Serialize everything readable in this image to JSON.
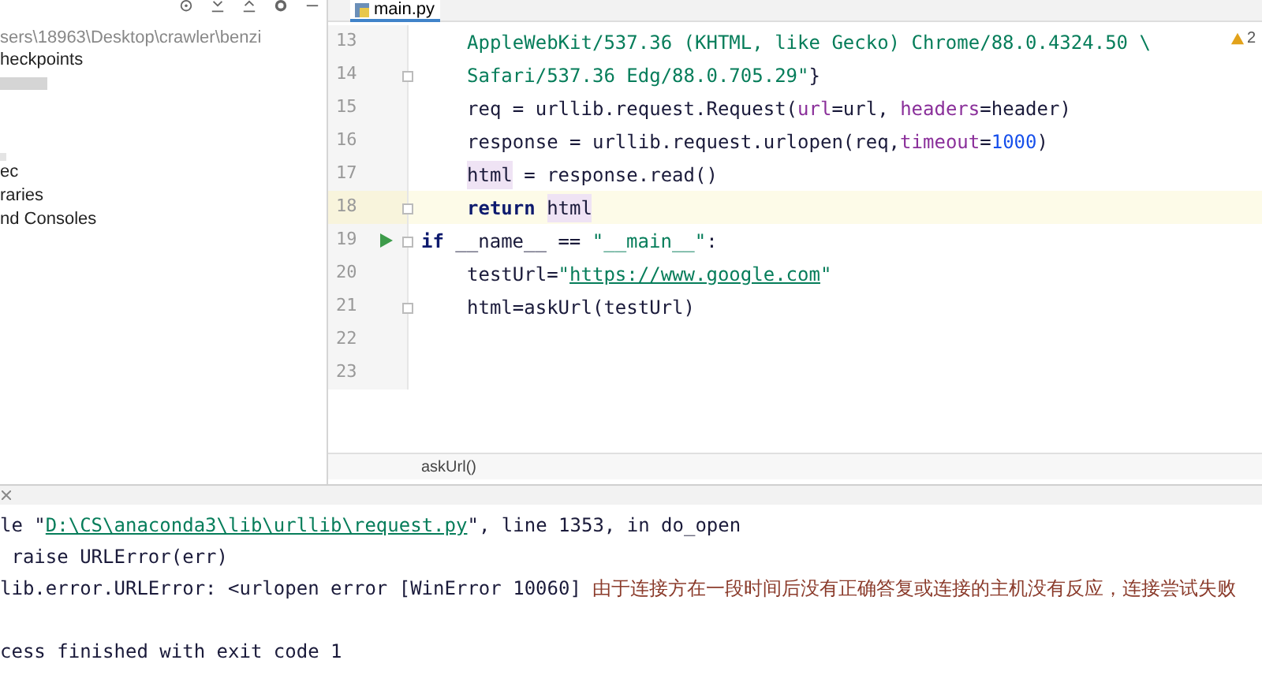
{
  "project_panel": {
    "path": "sers\\18963\\Desktop\\crawler\\benzi",
    "items": [
      {
        "label": "heckpoints",
        "kind": "text"
      },
      {
        "kind": "blurred"
      },
      {
        "label": "ec",
        "kind": "text"
      },
      {
        "label": "raries",
        "kind": "text"
      },
      {
        "label": "nd Consoles",
        "kind": "text"
      }
    ]
  },
  "editor": {
    "tab": {
      "label": "main.py",
      "selected": true
    },
    "warning_count": "2",
    "breadcrumb": "askUrl()",
    "lines": [
      {
        "number": "13",
        "indented": true,
        "current": false,
        "run": false,
        "fold": false,
        "segments": [
          {
            "text": "AppleWebKit/537.36 (KHTML, like Gecko) Chrome/88.0.4324.50 \\",
            "kind": "string"
          }
        ]
      },
      {
        "number": "14",
        "indented": true,
        "current": false,
        "run": false,
        "fold": true,
        "segments": [
          {
            "text": "Safari/537.36 Edg/88.0.705.29\"",
            "kind": "string"
          },
          {
            "text": "}",
            "kind": "plain"
          }
        ]
      },
      {
        "number": "15",
        "indented": true,
        "current": false,
        "run": false,
        "fold": false,
        "segments": [
          {
            "text": "req = urllib.request.Request(",
            "kind": "plain"
          },
          {
            "text": "url",
            "kind": "param"
          },
          {
            "text": "=url, ",
            "kind": "plain"
          },
          {
            "text": "headers",
            "kind": "param"
          },
          {
            "text": "=header)",
            "kind": "plain"
          }
        ]
      },
      {
        "number": "16",
        "indented": true,
        "current": false,
        "run": false,
        "fold": false,
        "segments": [
          {
            "text": "response = urllib.request.urlopen(req,",
            "kind": "plain"
          },
          {
            "text": "timeout",
            "kind": "param"
          },
          {
            "text": "=",
            "kind": "plain"
          },
          {
            "text": "1000",
            "kind": "number"
          },
          {
            "text": ")",
            "kind": "plain"
          }
        ]
      },
      {
        "number": "17",
        "indented": true,
        "current": false,
        "run": false,
        "fold": false,
        "segments": [
          {
            "text": "html",
            "kind": "usage"
          },
          {
            "text": " = response.read()",
            "kind": "plain"
          }
        ]
      },
      {
        "number": "18",
        "indented": true,
        "current": true,
        "run": false,
        "fold": true,
        "segments": [
          {
            "text": "return ",
            "kind": "keyword"
          },
          {
            "text": "html",
            "kind": "usage"
          }
        ]
      },
      {
        "number": "19",
        "indented": false,
        "current": false,
        "run": true,
        "fold": true,
        "segments": [
          {
            "text": "if",
            "kind": "keyword"
          },
          {
            "text": " __name__ == ",
            "kind": "plain"
          },
          {
            "text": "\"__main__\"",
            "kind": "string"
          },
          {
            "text": ":",
            "kind": "plain"
          }
        ]
      },
      {
        "number": "20",
        "indented": true,
        "current": false,
        "run": false,
        "fold": false,
        "segments": [
          {
            "text": "testUrl=",
            "kind": "plain"
          },
          {
            "text": "\"",
            "kind": "string"
          },
          {
            "text": "https://www.google.com",
            "kind": "link"
          },
          {
            "text": "\"",
            "kind": "string"
          }
        ]
      },
      {
        "number": "21",
        "indented": true,
        "current": false,
        "run": false,
        "fold": true,
        "segments": [
          {
            "text": "html=askUrl(testUrl)",
            "kind": "plain"
          }
        ]
      },
      {
        "number": "22",
        "current": false,
        "run": false,
        "fold": false
      },
      {
        "number": "23",
        "current": false,
        "run": false,
        "fold": false
      }
    ]
  },
  "console": {
    "trace": [
      {
        "segments": [
          {
            "text": "le \"",
            "kind": "plain"
          },
          {
            "text": "D:\\CS\\anaconda3\\lib\\urllib\\request.py",
            "kind": "link"
          },
          {
            "text": "\", line 1353, in do_open",
            "kind": "plain"
          }
        ]
      },
      {
        "segments": [
          {
            "text": " raise URLError(err)",
            "kind": "plain"
          }
        ]
      },
      {
        "segments": [
          {
            "text": "lib.error.URLError: <urlopen error [WinError 10060] ",
            "kind": "plain"
          },
          {
            "text": "由于连接方在一段时间后没有正确答复或连接的主机没有反应，连接尝试失败",
            "kind": "cjk"
          }
        ]
      },
      {
        "segments": [
          {
            "text": "cess finished with exit code 1",
            "kind": "plain"
          }
        ]
      }
    ]
  }
}
